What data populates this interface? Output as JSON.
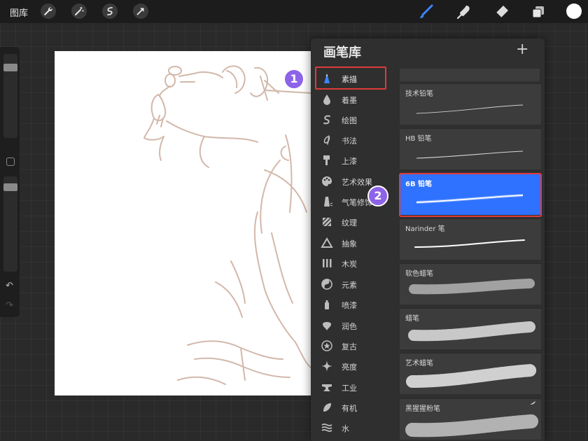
{
  "topbar": {
    "gallery_label": "图库",
    "left_tools": [
      "wrench-icon",
      "magic-wand-icon",
      "selection-icon",
      "transform-arrow-icon"
    ],
    "right_tools": [
      "brush-icon",
      "smudge-icon",
      "eraser-icon",
      "layers-icon"
    ],
    "current_color": "#ffffff"
  },
  "brush_library": {
    "title": "画笔库",
    "add_symbol": "+",
    "categories": [
      {
        "label": "素描",
        "icon": "pencil-tip-icon",
        "active": true
      },
      {
        "label": "着墨",
        "icon": "ink-drop-icon"
      },
      {
        "label": "绘图",
        "icon": "squiggle-icon"
      },
      {
        "label": "书法",
        "icon": "calligraphy-icon"
      },
      {
        "label": "上漆",
        "icon": "paint-roller-icon"
      },
      {
        "label": "艺术效果",
        "icon": "palette-icon"
      },
      {
        "label": "气笔修饰",
        "icon": "airbrush-icon"
      },
      {
        "label": "纹理",
        "icon": "texture-icon"
      },
      {
        "label": "抽象",
        "icon": "triangle-icon"
      },
      {
        "label": "木炭",
        "icon": "charcoal-icon"
      },
      {
        "label": "元素",
        "icon": "yin-yang-icon"
      },
      {
        "label": "喷漆",
        "icon": "spray-can-icon"
      },
      {
        "label": "润色",
        "icon": "blob-icon"
      },
      {
        "label": "复古",
        "icon": "star-badge-icon"
      },
      {
        "label": "亮度",
        "icon": "sparkle-icon"
      },
      {
        "label": "工业",
        "icon": "anvil-icon"
      },
      {
        "label": "有机",
        "icon": "leaf-icon"
      },
      {
        "label": "水",
        "icon": "waves-icon"
      }
    ],
    "brushes": [
      {
        "label": "技术铅笔",
        "style": "thin"
      },
      {
        "label": "HB 铅笔",
        "style": "thin"
      },
      {
        "label": "6B 铅笔",
        "style": "glow",
        "selected": true
      },
      {
        "label": "Narinder 笔",
        "style": "solid"
      },
      {
        "label": "软色蜡笔",
        "style": "soft"
      },
      {
        "label": "蜡笔",
        "style": "crayon"
      },
      {
        "label": "艺术蜡笔",
        "style": "art"
      },
      {
        "label": "黑猩猩粉笔",
        "style": "chalk"
      }
    ]
  },
  "steps": [
    "1",
    "2"
  ],
  "colors": {
    "accent": "#2f72ff",
    "highlight": "#e03a3a",
    "step": "#8d63e8",
    "sketch": "#d2b8aa"
  }
}
